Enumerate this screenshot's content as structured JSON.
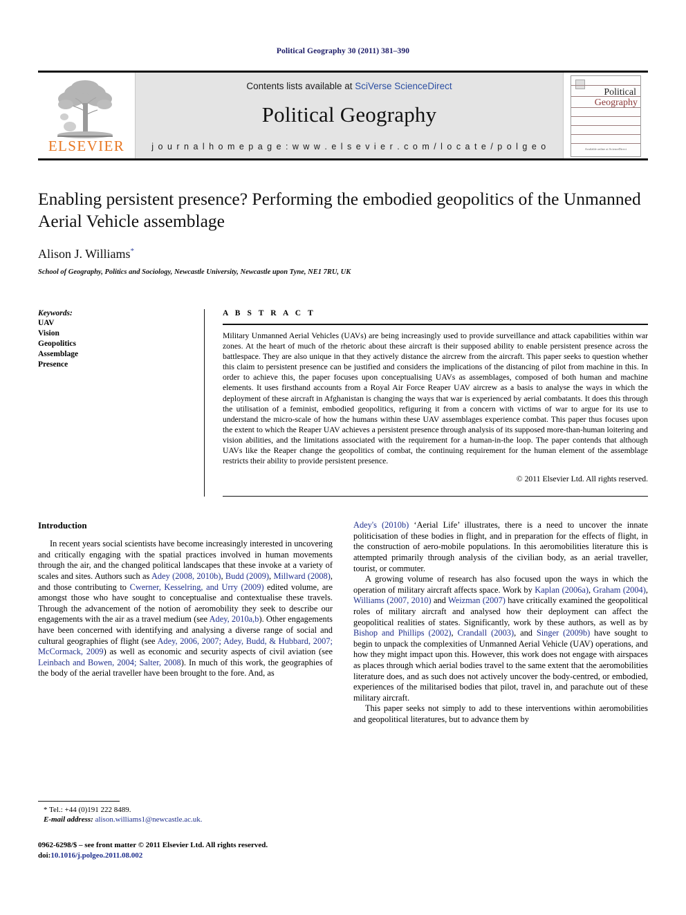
{
  "running_head": "Political Geography 30 (2011) 381–390",
  "masthead": {
    "publisher_name": "ELSEVIER",
    "publisher_logo_icon": "elsevier-tree-icon",
    "contents_prefix": "Contents lists available at ",
    "contents_link": "SciVerse ScienceDirect",
    "journal_title": "Political Geography",
    "homepage_line": "j o u r n a l   h o m e p a g e :   w w w . e l s e v i e r . c o m / l o c a t e / p o l g e o",
    "cover": {
      "line1": "Political",
      "line2": "Geography",
      "footer": "Available online at\nScienceDirect"
    }
  },
  "article": {
    "title": "Enabling persistent presence? Performing the embodied geopolitics of the Unmanned Aerial Vehicle assemblage",
    "author": "Alison J. Williams",
    "author_marker": "*",
    "affiliation": "School of Geography, Politics and Sociology, Newcastle University, Newcastle upon Tyne, NE1 7RU, UK"
  },
  "keywords": {
    "heading": "Keywords:",
    "items": [
      "UAV",
      "Vision",
      "Geopolitics",
      "Assemblage",
      "Presence"
    ]
  },
  "abstract": {
    "heading": "A B S T R A C T",
    "text": "Military Unmanned Aerial Vehicles (UAVs) are being increasingly used to provide surveillance and attack capabilities within war zones. At the heart of much of the rhetoric about these aircraft is their supposed ability to enable persistent presence across the battlespace. They are also unique in that they actively distance the aircrew from the aircraft. This paper seeks to question whether this claim to persistent presence can be justified and considers the implications of the distancing of pilot from machine in this. In order to achieve this, the paper focuses upon conceptualising UAVs as assemblages, composed of both human and machine elements. It uses firsthand accounts from a Royal Air Force Reaper UAV aircrew as a basis to analyse the ways in which the deployment of these aircraft in Afghanistan is changing the ways that war is experienced by aerial combatants. It does this through the utilisation of a feminist, embodied geopolitics, refiguring it from a concern with victims of war to argue for its use to understand the micro-scale of how the humans within these UAV assemblages experience combat. This paper thus focuses upon the extent to which the Reaper UAV achieves a persistent presence through analysis of its supposed more-than-human loitering and vision abilities, and the limitations associated with the requirement for a human-in-the loop. The paper contends that although UAVs like the Reaper change the geopolitics of combat, the continuing requirement for the human element of the assemblage restricts their ability to provide persistent presence.",
    "copyright": "© 2011 Elsevier Ltd. All rights reserved."
  },
  "body": {
    "section_heading": "Introduction",
    "left_par1_a": "In recent years social scientists have become increasingly interested in uncovering and critically engaging with the spatial practices involved in human movements through the air, and the changed political landscapes that these invoke at a variety of scales and sites. Authors such as ",
    "cite_adey_2008": "Adey (2008, 2010b)",
    "left_par1_b": ", ",
    "cite_budd_2009": "Budd (2009)",
    "left_par1_c": ", ",
    "cite_millward_2008": "Millward (2008)",
    "left_par1_d": ", and those contributing to ",
    "cite_cwerner": "Cwerner, Kesselring, and Urry (2009)",
    "left_par1_e": " edited volume, are amongst those who have sought to conceptualise and contextualise these travels. Through the advancement of the notion of aeromobility they seek to describe our engagements with the air as a travel medium (see ",
    "cite_adey_2010ab": "Adey, 2010a,b",
    "left_par1_f": "). Other engagements have been concerned with identifying and analysing a diverse range of social and cultural geographies of flight (see ",
    "cite_adey_2006_2007": "Adey, 2006, 2007; Adey, Budd, & Hubbard, 2007; McCormack, 2009",
    "left_par1_g": ") as well as economic and security aspects of civil aviation (see ",
    "cite_leinbach": "Leinbach and Bowen, 2004; Salter, 2008",
    "left_par1_h": "). In much of this work, the geographies of the body of the aerial traveller have been brought to the fore. And, as",
    "right_par1_a": "",
    "cite_adey_2010b_right": "Adey's (2010b)",
    "right_par1_b": " ‘Aerial Life’ illustrates, there is a need to uncover the innate politicisation of these bodies in flight, and in preparation for the effects of flight, in the construction of aero-mobile populations. In this aeromobilities literature this is attempted primarily through analysis of the civilian body, as an aerial traveller, tourist, or commuter.",
    "right_par2_a": "A growing volume of research has also focused upon the ways in which the operation of military aircraft affects space. Work by ",
    "cite_kaplan": "Kaplan (2006a)",
    "right_par2_b": ", ",
    "cite_graham": "Graham (2004)",
    "right_par2_c": ", ",
    "cite_williams": "Williams (2007, 2010)",
    "right_par2_d": " and ",
    "cite_weizman": "Weizman (2007)",
    "right_par2_e": " have critically examined the geopolitical roles of military aircraft and analysed how their deployment can affect the geopolitical realities of states. Significantly, work by these authors, as well as by ",
    "cite_bishop": "Bishop and Phillips (2002)",
    "right_par2_f": ", ",
    "cite_crandall": "Crandall (2003)",
    "right_par2_g": ", and ",
    "cite_singer": "Singer (2009b)",
    "right_par2_h": " have sought to begin to unpack the complexities of Unmanned Aerial Vehicle (UAV) operations, and how they might impact upon this. However, this work does not engage with airspaces as places through which aerial bodies travel to the same extent that the aeromobilities literature does, and as such does not actively uncover the body-centred, or embodied, experiences of the militarised bodies that pilot, travel in, and parachute out of these military aircraft.",
    "right_par3": "This paper seeks not simply to add to these interventions within aeromobilities and geopolitical literatures, but to advance them by"
  },
  "footnote": {
    "tel": "* Tel.: +44 (0)191 222 8489.",
    "email_label": "E-mail address:",
    "email": "alison.williams1@newcastle.ac.uk."
  },
  "page_footer": {
    "front_matter": "0962-6298/$ – see front matter © 2011 Elsevier Ltd. All rights reserved.",
    "doi_label": "doi:",
    "doi": "10.1016/j.polgeo.2011.08.002"
  },
  "colors": {
    "running_head": "#1a1a66",
    "link": "#1f2f8c",
    "elsevier_orange": "#e87722",
    "masthead_bg": "#e4e4e4"
  }
}
